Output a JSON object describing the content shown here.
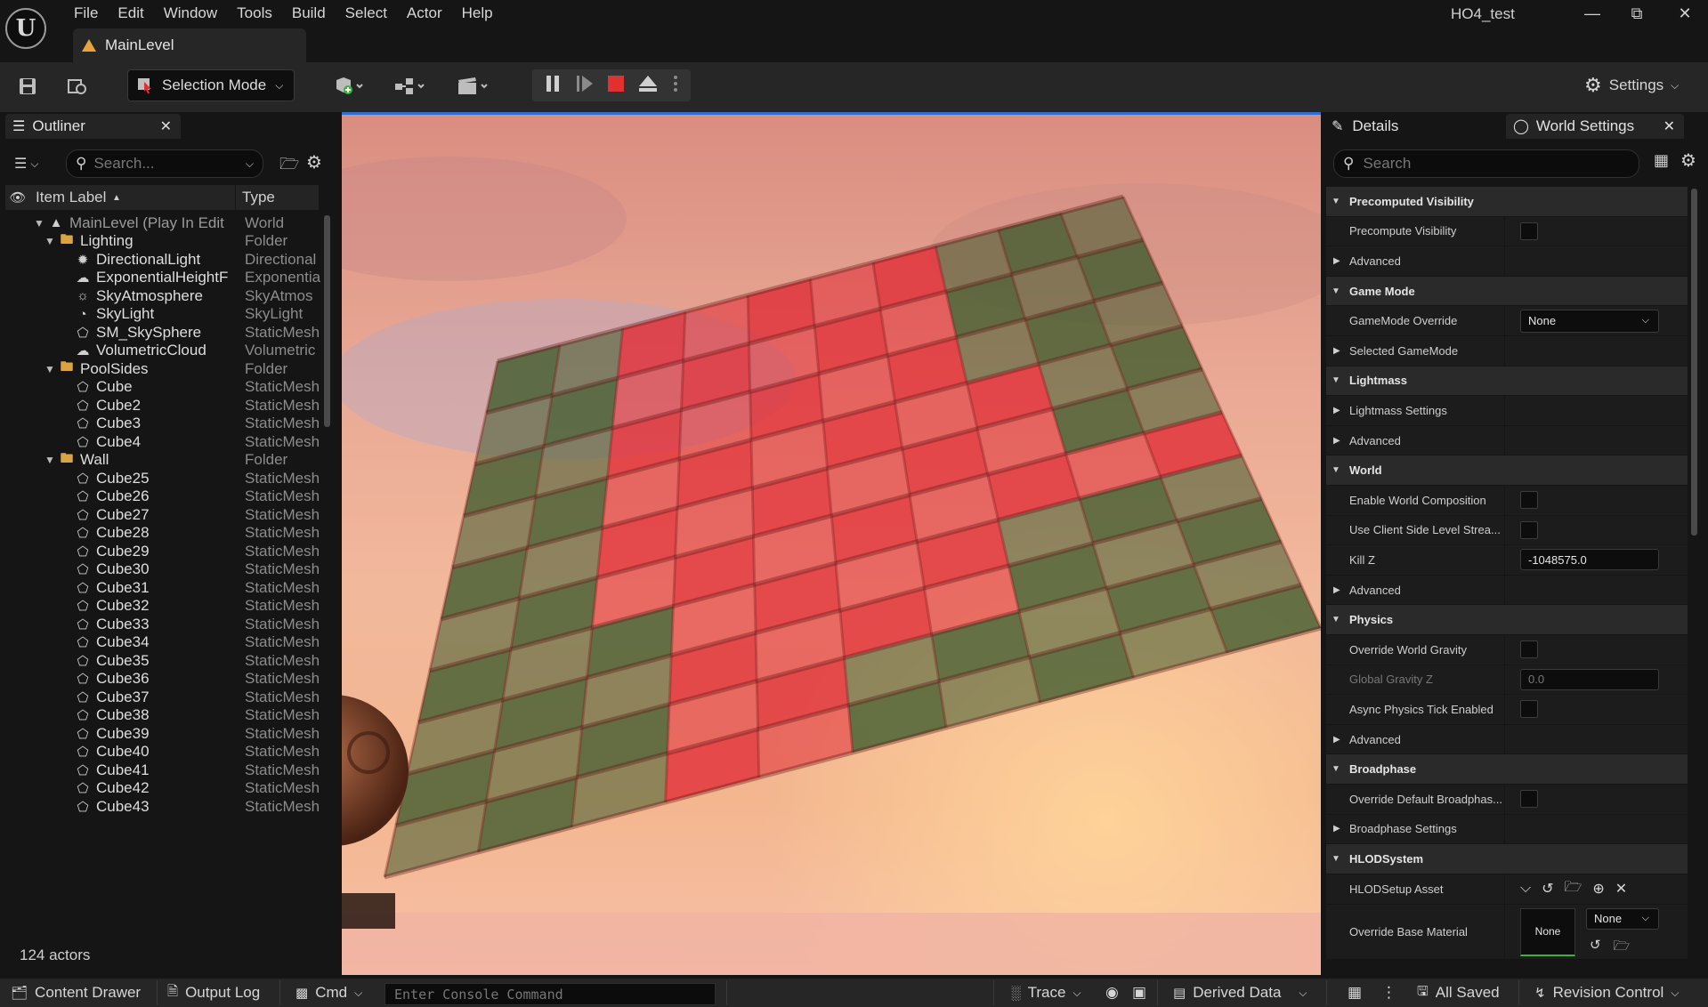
{
  "app": {
    "project_name": "HO4_test",
    "logo_glyph": "U",
    "level_tab": "MainLevel"
  },
  "menu": [
    "File",
    "Edit",
    "Window",
    "Tools",
    "Build",
    "Select",
    "Actor",
    "Help"
  ],
  "toolbar": {
    "selection_mode": "Selection Mode",
    "settings": "Settings"
  },
  "outliner": {
    "title": "Outliner",
    "search_placeholder": "Search...",
    "col_label": "Item Label",
    "col_type": "Type",
    "rows": [
      {
        "label": "MainLevel (Play In Edit",
        "type": "World",
        "depth": 0,
        "icon": "level-icon",
        "expanded": true,
        "dim": true
      },
      {
        "label": "Lighting",
        "type": "Folder",
        "depth": 1,
        "icon": "folder-icon",
        "expanded": true
      },
      {
        "label": "DirectionalLight",
        "type": "Directional",
        "depth": 2,
        "icon": "directional-light-icon"
      },
      {
        "label": "ExponentialHeightF",
        "type": "Exponentia",
        "depth": 2,
        "icon": "fog-icon"
      },
      {
        "label": "SkyAtmosphere",
        "type": "SkyAtmos",
        "depth": 2,
        "icon": "sky-atmosphere-icon"
      },
      {
        "label": "SkyLight",
        "type": "SkyLight",
        "depth": 2,
        "icon": "skylight-icon"
      },
      {
        "label": "SM_SkySphere",
        "type": "StaticMesh",
        "depth": 2,
        "icon": "static-mesh-icon"
      },
      {
        "label": "VolumetricCloud",
        "type": "Volumetric",
        "depth": 2,
        "icon": "cloud-icon"
      },
      {
        "label": "PoolSides",
        "type": "Folder",
        "depth": 1,
        "icon": "folder-icon",
        "expanded": true
      },
      {
        "label": "Cube",
        "type": "StaticMesh",
        "depth": 2,
        "icon": "static-mesh-icon"
      },
      {
        "label": "Cube2",
        "type": "StaticMesh",
        "depth": 2,
        "icon": "static-mesh-icon"
      },
      {
        "label": "Cube3",
        "type": "StaticMesh",
        "depth": 2,
        "icon": "static-mesh-icon"
      },
      {
        "label": "Cube4",
        "type": "StaticMesh",
        "depth": 2,
        "icon": "static-mesh-icon"
      },
      {
        "label": "Wall",
        "type": "Folder",
        "depth": 1,
        "icon": "folder-icon",
        "expanded": true
      },
      {
        "label": "Cube25",
        "type": "StaticMesh",
        "depth": 2,
        "icon": "static-mesh-icon"
      },
      {
        "label": "Cube26",
        "type": "StaticMesh",
        "depth": 2,
        "icon": "static-mesh-icon"
      },
      {
        "label": "Cube27",
        "type": "StaticMesh",
        "depth": 2,
        "icon": "static-mesh-icon"
      },
      {
        "label": "Cube28",
        "type": "StaticMesh",
        "depth": 2,
        "icon": "static-mesh-icon"
      },
      {
        "label": "Cube29",
        "type": "StaticMesh",
        "depth": 2,
        "icon": "static-mesh-icon"
      },
      {
        "label": "Cube30",
        "type": "StaticMesh",
        "depth": 2,
        "icon": "static-mesh-icon"
      },
      {
        "label": "Cube31",
        "type": "StaticMesh",
        "depth": 2,
        "icon": "static-mesh-icon"
      },
      {
        "label": "Cube32",
        "type": "StaticMesh",
        "depth": 2,
        "icon": "static-mesh-icon"
      },
      {
        "label": "Cube33",
        "type": "StaticMesh",
        "depth": 2,
        "icon": "static-mesh-icon"
      },
      {
        "label": "Cube34",
        "type": "StaticMesh",
        "depth": 2,
        "icon": "static-mesh-icon"
      },
      {
        "label": "Cube35",
        "type": "StaticMesh",
        "depth": 2,
        "icon": "static-mesh-icon"
      },
      {
        "label": "Cube36",
        "type": "StaticMesh",
        "depth": 2,
        "icon": "static-mesh-icon"
      },
      {
        "label": "Cube37",
        "type": "StaticMesh",
        "depth": 2,
        "icon": "static-mesh-icon"
      },
      {
        "label": "Cube38",
        "type": "StaticMesh",
        "depth": 2,
        "icon": "static-mesh-icon"
      },
      {
        "label": "Cube39",
        "type": "StaticMesh",
        "depth": 2,
        "icon": "static-mesh-icon"
      },
      {
        "label": "Cube40",
        "type": "StaticMesh",
        "depth": 2,
        "icon": "static-mesh-icon"
      },
      {
        "label": "Cube41",
        "type": "StaticMesh",
        "depth": 2,
        "icon": "static-mesh-icon"
      },
      {
        "label": "Cube42",
        "type": "StaticMesh",
        "depth": 2,
        "icon": "static-mesh-icon"
      },
      {
        "label": "Cube43",
        "type": "StaticMesh",
        "depth": 2,
        "icon": "static-mesh-icon"
      }
    ],
    "actor_count": "124 actors"
  },
  "details": {
    "tab_details": "Details",
    "tab_world_settings": "World Settings",
    "search_placeholder": "Search",
    "rows": [
      {
        "kind": "cat",
        "label": "Precomputed Visibility"
      },
      {
        "kind": "check",
        "label": "Precompute Visibility"
      },
      {
        "kind": "sub",
        "label": "Advanced"
      },
      {
        "kind": "cat",
        "label": "Game Mode"
      },
      {
        "kind": "dropdown",
        "label": "GameMode Override",
        "value": "None"
      },
      {
        "kind": "sub",
        "label": "Selected GameMode"
      },
      {
        "kind": "cat",
        "label": "Lightmass"
      },
      {
        "kind": "sub",
        "label": "Lightmass Settings"
      },
      {
        "kind": "sub",
        "label": "Advanced"
      },
      {
        "kind": "cat",
        "label": "World"
      },
      {
        "kind": "check",
        "label": "Enable World Composition"
      },
      {
        "kind": "check",
        "label": "Use Client Side Level Strea..."
      },
      {
        "kind": "field",
        "label": "Kill Z",
        "value": "-1048575.0"
      },
      {
        "kind": "sub",
        "label": "Advanced"
      },
      {
        "kind": "cat",
        "label": "Physics"
      },
      {
        "kind": "check",
        "label": "Override World Gravity"
      },
      {
        "kind": "fielddim",
        "label": "Global Gravity Z",
        "value": "0.0"
      },
      {
        "kind": "check",
        "label": "Async Physics Tick Enabled"
      },
      {
        "kind": "sub",
        "label": "Advanced"
      },
      {
        "kind": "cat",
        "label": "Broadphase"
      },
      {
        "kind": "check",
        "label": "Override Default Broadphas..."
      },
      {
        "kind": "sub",
        "label": "Broadphase Settings"
      },
      {
        "kind": "cat",
        "label": "HLODSystem"
      },
      {
        "kind": "asset",
        "label": "HLODSetup Asset"
      },
      {
        "kind": "material",
        "label": "Override Base Material",
        "value": "None",
        "thumb": "None"
      }
    ]
  },
  "statusbar": {
    "content_drawer": "Content Drawer",
    "output_log": "Output Log",
    "cmd": "Cmd",
    "console_placeholder": "Enter Console Command",
    "trace": "Trace",
    "derived_data": "Derived Data",
    "all_saved": "All Saved",
    "revision_control": "Revision Control"
  },
  "colors": {
    "accent_play_stop": "#e03030",
    "viewport_sky": "#e8a08a",
    "wall_red": "#e02a35",
    "wall_green": "#3c5a2c"
  }
}
